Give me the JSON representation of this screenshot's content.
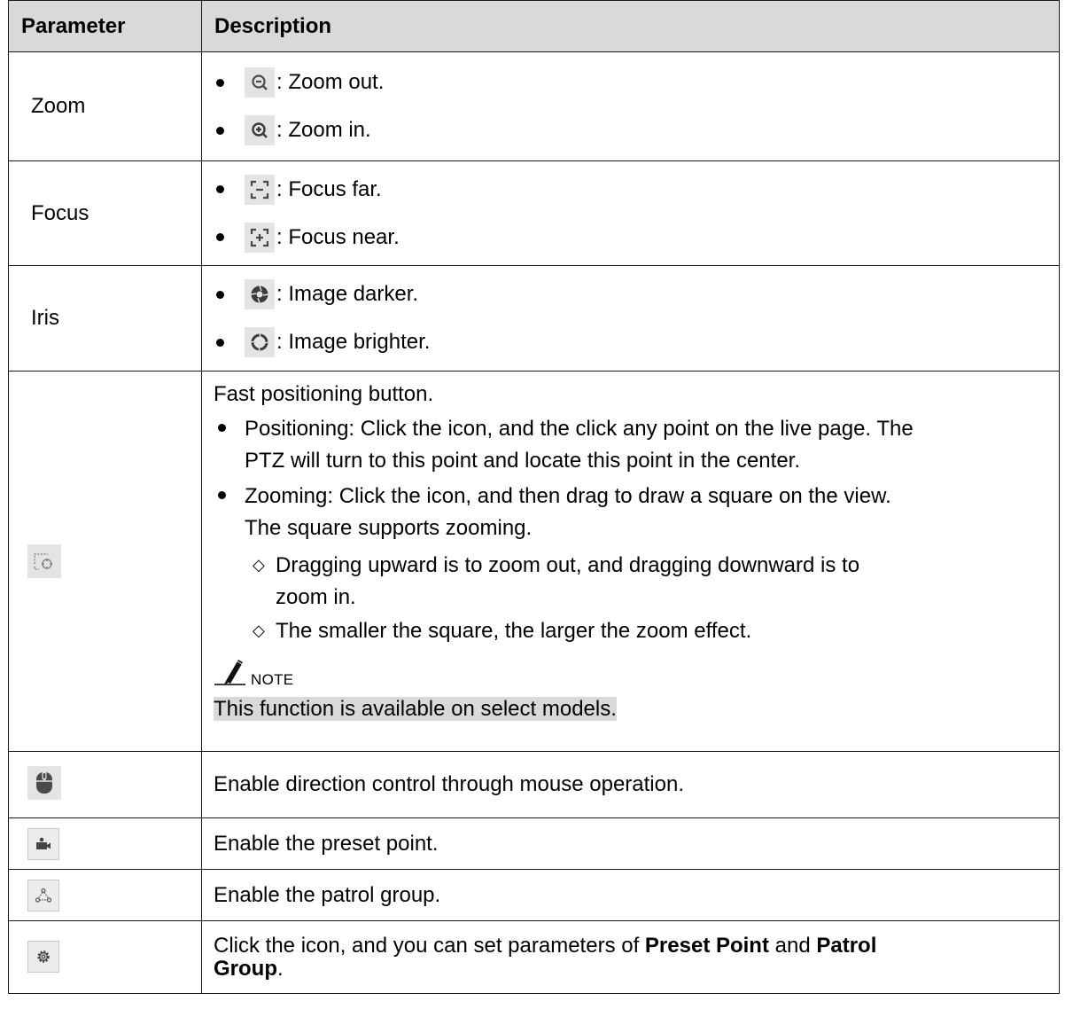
{
  "headers": {
    "parameter": "Parameter",
    "description": "Description"
  },
  "rows": {
    "zoom": {
      "param": "Zoom",
      "item1": ": Zoom out.",
      "item2": ": Zoom in.",
      "icon1": "zoom-out-icon",
      "icon2": "zoom-in-icon"
    },
    "focus": {
      "param": "Focus",
      "item1": ": Focus far.",
      "item2": ": Focus near.",
      "icon1": "focus-far-icon",
      "icon2": "focus-near-icon"
    },
    "iris": {
      "param": "Iris",
      "item1": ": Image darker.",
      "item2": ": Image brighter.",
      "icon1": "iris-close-icon",
      "icon2": "iris-open-icon"
    },
    "fast": {
      "icon": "fast-positioning-icon",
      "intro": "Fast positioning button.",
      "b1a": "Positioning: Click the icon, and the click any point on the live page. The",
      "b1b": "PTZ will turn to this point and locate this point in the center.",
      "b2a": "Zooming: Click the icon, and then drag to draw a square on the view.",
      "b2b": "The square supports zooming.",
      "s1a": "Dragging upward is to zoom out, and dragging downward is to",
      "s1b": "zoom in.",
      "s2": "The smaller the square, the larger the zoom effect.",
      "note_label": "NOTE",
      "note_text": "This function is available on select models."
    },
    "mouse": {
      "icon": "mouse-icon",
      "text": "Enable direction control through mouse operation."
    },
    "preset": {
      "icon": "camera-icon",
      "text": "Enable the preset point."
    },
    "patrol": {
      "icon": "patrol-icon",
      "text": "Enable the patrol group."
    },
    "settings": {
      "icon": "gear-icon",
      "t1": "Click the icon, and you can set parameters of ",
      "b1": "Preset Point",
      "t2": " and ",
      "b2": "Patrol",
      "b3": "Group",
      "t3": "."
    }
  }
}
